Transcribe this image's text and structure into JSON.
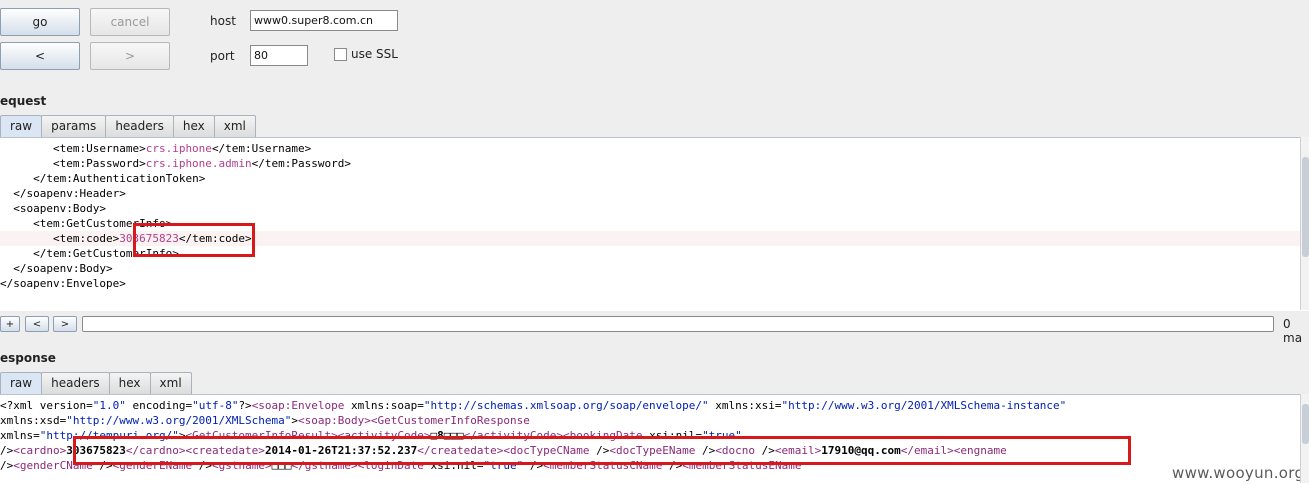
{
  "toolbar": {
    "go_label": "go",
    "cancel_label": "cancel",
    "prev_label": "<",
    "next_label": ">",
    "host_label": "host",
    "host_value": "www0.super8.com.cn",
    "port_label": "port",
    "port_value": "80",
    "ssl_label": "use SSL",
    "ssl_checked": false
  },
  "request": {
    "title": "equest",
    "tabs": [
      "raw",
      "params",
      "headers",
      "hex",
      "xml"
    ],
    "active_tab": "raw",
    "lines": [
      {
        "indent": "        ",
        "parts": [
          [
            "tag",
            "<tem:Username>"
          ],
          [
            "val",
            "crs.iphone"
          ],
          [
            "tag",
            "</tem:Username>"
          ]
        ]
      },
      {
        "indent": "        ",
        "parts": [
          [
            "tag",
            "<tem:Password>"
          ],
          [
            "val",
            "crs.iphone.admin"
          ],
          [
            "tag",
            "</tem:Password>"
          ]
        ]
      },
      {
        "indent": "     ",
        "parts": [
          [
            "tag",
            "</tem:AuthenticationToken>"
          ]
        ]
      },
      {
        "indent": "  ",
        "parts": [
          [
            "tag",
            "</soapenv:Header>"
          ]
        ]
      },
      {
        "indent": "  ",
        "parts": [
          [
            "tag",
            "<soapenv:Body>"
          ]
        ]
      },
      {
        "indent": "     ",
        "parts": [
          [
            "tag",
            "<tem:GetCustomerInfo>"
          ]
        ]
      },
      {
        "indent": "        ",
        "parts": [
          [
            "tag",
            "<tem:code>"
          ],
          [
            "val",
            "303675823"
          ],
          [
            "tag",
            "</tem:code>"
          ]
        ],
        "highlight": true
      },
      {
        "indent": "     ",
        "parts": [
          [
            "tag",
            "</tem:GetCustomerInfo>"
          ]
        ]
      },
      {
        "indent": "  ",
        "parts": [
          [
            "tag",
            "</soapenv:Body>"
          ]
        ]
      },
      {
        "indent": "",
        "parts": [
          [
            "tag",
            "</soapenv:Envelope>"
          ]
        ]
      }
    ],
    "search": {
      "plus_label": "+",
      "prev_label": "<",
      "next_label": ">",
      "value": "",
      "matches_label": "0 ma"
    }
  },
  "response": {
    "title": "esponse",
    "tabs": [
      "raw",
      "headers",
      "hex",
      "xml"
    ],
    "active_tab": "raw",
    "lines": [
      {
        "parts": [
          [
            "xattr",
            "<?xml version="
          ],
          [
            "xstr",
            "\"1.0\""
          ],
          [
            "xattr",
            " encoding="
          ],
          [
            "xstr",
            "\"utf-8\""
          ],
          [
            "xattr",
            "?>"
          ],
          [
            "xtag",
            "<soap:Envelope"
          ],
          [
            "xattr",
            " xmlns:soap="
          ],
          [
            "xstr",
            "\"http://schemas.xmlsoap.org/soap/envelope/\""
          ],
          [
            "xattr",
            " xmlns:xsi="
          ],
          [
            "xstr",
            "\"http://www.w3.org/2001/XMLSchema-instance\""
          ]
        ]
      },
      {
        "parts": [
          [
            "xattr",
            "xmlns:xsd="
          ],
          [
            "xstr",
            "\"http://www.w3.org/2001/XMLSchema\""
          ],
          [
            "xattr",
            ">"
          ],
          [
            "xtag",
            "<soap:Body>"
          ],
          [
            "xtag",
            "<GetCustomerInfoResponse"
          ]
        ]
      },
      {
        "parts": [
          [
            "xattr",
            "xmlns="
          ],
          [
            "xstr",
            "\"http://tempuri.org/\""
          ],
          [
            "xattr",
            ">"
          ],
          [
            "xtag",
            "<GetCustomerInfoResult>"
          ],
          [
            "xtag",
            "<activityCode>"
          ],
          [
            "bold",
            "□8□□□"
          ],
          [
            "xtag",
            "</activityCode>"
          ],
          [
            "xtag",
            "<bookingDate"
          ],
          [
            "xattr",
            " xsi:nil="
          ],
          [
            "xstr",
            "\"true\""
          ]
        ]
      },
      {
        "parts": [
          [
            "xattr",
            "/>"
          ],
          [
            "xtag",
            "<cardno>"
          ],
          [
            "bold",
            "303675823"
          ],
          [
            "xtag",
            "</cardno>"
          ],
          [
            "xtag",
            "<createdate>"
          ],
          [
            "bold",
            "2014-01-26T21:37:52.237"
          ],
          [
            "xtag",
            "</createdate>"
          ],
          [
            "xtag",
            "<docTypeCName"
          ],
          [
            "xattr",
            " />"
          ],
          [
            "xtag",
            "<docTypeEName"
          ],
          [
            "xattr",
            " />"
          ],
          [
            "xtag",
            "<docno"
          ],
          [
            "xattr",
            " />"
          ],
          [
            "xtag",
            "<email>"
          ],
          [
            "bold",
            "17910@qq.com"
          ],
          [
            "xtag",
            "</email>"
          ],
          [
            "xtag",
            "<engname"
          ]
        ]
      },
      {
        "parts": [
          [
            "xattr",
            "/>"
          ],
          [
            "xtag",
            "<genderCName"
          ],
          [
            "xattr",
            " />"
          ],
          [
            "xtag",
            "<genderEName"
          ],
          [
            "xattr",
            " />"
          ],
          [
            "xtag",
            "<gstname>"
          ],
          [
            "bold",
            "□□□"
          ],
          [
            "xtag",
            "</gstname>"
          ],
          [
            "xtag",
            "<loginDate"
          ],
          [
            "xattr",
            " xsi:nil="
          ],
          [
            "xstr",
            "\"true\""
          ],
          [
            "xattr",
            " />"
          ],
          [
            "xtag",
            "<memberStatusCName"
          ],
          [
            "xattr",
            " />"
          ],
          [
            "xtag",
            "<memberStatusEName"
          ]
        ]
      }
    ]
  },
  "watermark": "www.wooyun.org",
  "colors": {
    "highlight_box": "#d7191c",
    "value_text": "#b13f8d",
    "xml_tag": "#8a2a7a",
    "xml_string": "#0020b0"
  }
}
